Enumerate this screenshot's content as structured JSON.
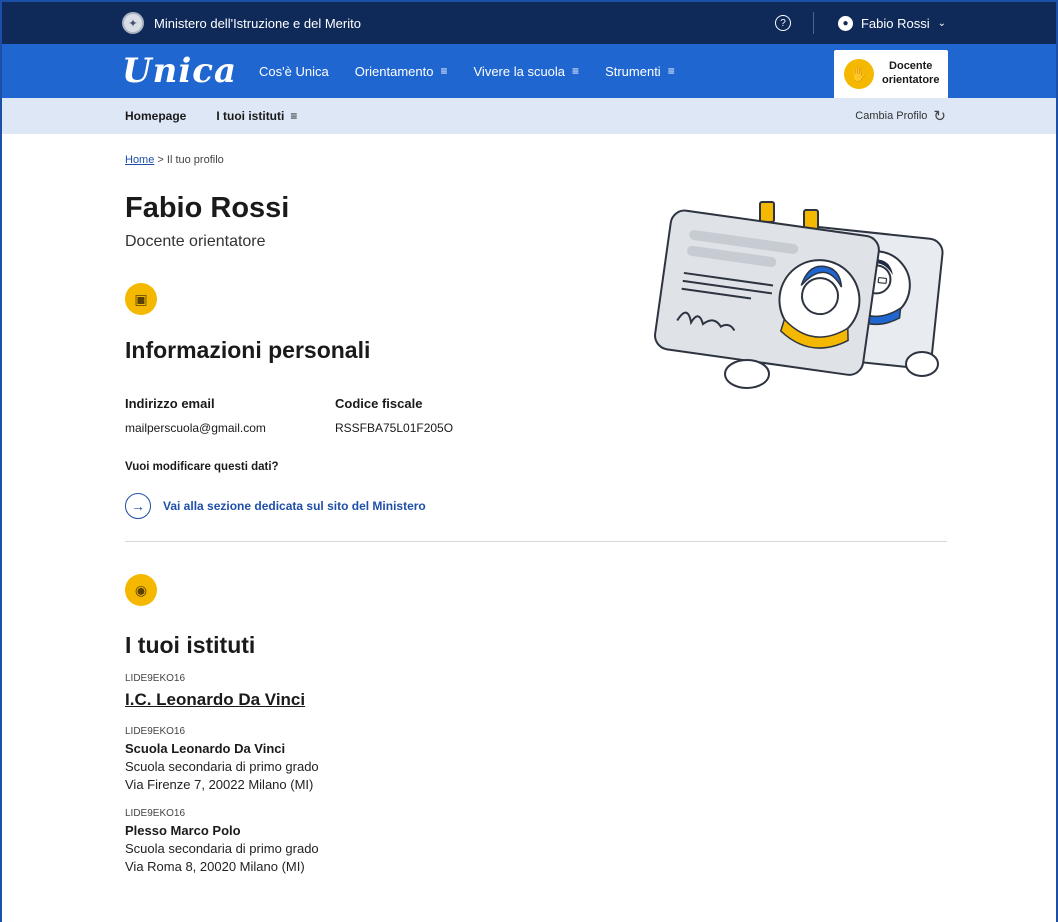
{
  "topbar": {
    "ministry": "Ministero dell'Istruzione e del Merito",
    "help_symbol": "?",
    "user_name": "Fabio Rossi",
    "chevron": "⌄"
  },
  "mainnav": {
    "logo": "Unica",
    "links": [
      {
        "label": "Cos'è Unica",
        "has_menu": false
      },
      {
        "label": "Orientamento",
        "has_menu": true
      },
      {
        "label": "Vivere la scuola",
        "has_menu": true
      },
      {
        "label": "Strumenti",
        "has_menu": true
      }
    ],
    "menu_symbol": "≡",
    "profile": {
      "line1": "Docente",
      "line2": "orientatore"
    }
  },
  "subnav": {
    "homepage": "Homepage",
    "istituti": "I tuoi istituti",
    "menu_symbol": "≡",
    "cambia": "Cambia Profilo"
  },
  "breadcrumb": {
    "home": "Home",
    "separator": ">",
    "current": "Il tuo profilo"
  },
  "profile": {
    "name": "Fabio Rossi",
    "role": "Docente orientatore"
  },
  "personal": {
    "title": "Informazioni personali",
    "email_label": "Indirizzo email",
    "email_value": "mailperscuola@gmail.com",
    "cf_label": "Codice fiscale",
    "cf_value": "RSSFBA75L01F205O",
    "question": "Vuoi modificare questi dati?",
    "link_label": "Vai alla sezione dedicata sul sito del Ministero",
    "arrow": "→"
  },
  "institutes": {
    "title": "I tuoi istituti",
    "main": {
      "code": "LIDE9EKO16",
      "name": "I.C. Leonardo Da Vinci"
    },
    "schools": [
      {
        "code": "LIDE9EKO16",
        "name": "Scuola Leonardo Da Vinci",
        "type": "Scuola secondaria di primo grado",
        "address": "Via Firenze 7, 20022 Milano (MI)"
      },
      {
        "code": "LIDE9EKO16",
        "name": "Plesso Marco Polo",
        "type": "Scuola secondaria di primo grado",
        "address": "Via Roma 8, 20020 Milano (MI)"
      }
    ]
  },
  "colors": {
    "topbar": "#0f2a59",
    "nav": "#1f66d1",
    "subnav": "#dde7f5",
    "accent": "#f5b800",
    "link": "#1f4fa8"
  },
  "icons": {
    "emblem": "republic-emblem-icon",
    "help": "help-circle-icon",
    "user": "user-circle-icon",
    "profile_badge": "badge-hand-icon",
    "cambia": "switch-profile-icon",
    "personal": "id-card-icon",
    "institutes": "school-location-icon",
    "arrow": "arrow-right-icon"
  }
}
